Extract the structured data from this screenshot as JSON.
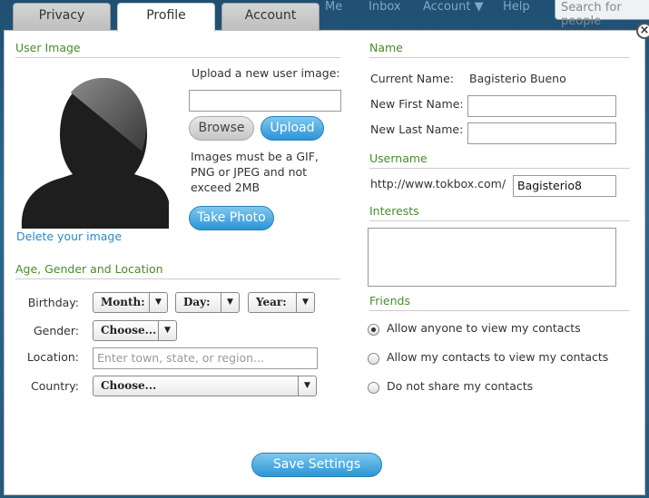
{
  "background_nav": {
    "items": [
      "Me",
      "Inbox",
      "Account ▼",
      "Help"
    ],
    "search_placeholder": "Search for people"
  },
  "tabs": [
    {
      "label": "Privacy",
      "active": false
    },
    {
      "label": "Profile",
      "active": true
    },
    {
      "label": "Account",
      "active": false
    }
  ],
  "user_image": {
    "section_title": "User Image",
    "upload_label": "Upload a new user image:",
    "browse_label": "Browse",
    "upload_button": "Upload",
    "note": "Images must be a GIF, PNG or JPEG and not exceed 2MB",
    "take_photo": "Take Photo",
    "delete_link": "Delete your image"
  },
  "age_gender": {
    "section_title": "Age, Gender and Location",
    "birthday_label": "Birthday:",
    "month": "Month:",
    "day": "Day:",
    "year": "Year:",
    "gender_label": "Gender:",
    "gender_value": "Choose...",
    "location_label": "Location:",
    "location_placeholder": "Enter town, state, or region...",
    "country_label": "Country:",
    "country_value": "Choose..."
  },
  "name": {
    "section_title": "Name",
    "current_label": "Current Name:",
    "current_value": "Bagisterio Bueno",
    "first_label": "New First Name:",
    "last_label": "New Last Name:"
  },
  "username": {
    "section_title": "Username",
    "prefix": "http://www.tokbox.com/",
    "value": "Bagisterio8"
  },
  "interests": {
    "section_title": "Interests"
  },
  "friends": {
    "section_title": "Friends",
    "options": [
      {
        "label": "Allow anyone to view my contacts",
        "selected": true
      },
      {
        "label": "Allow my contacts to view my contacts",
        "selected": false
      },
      {
        "label": "Do not share my contacts",
        "selected": false
      }
    ]
  },
  "save_label": "Save Settings",
  "close_glyph": "×"
}
